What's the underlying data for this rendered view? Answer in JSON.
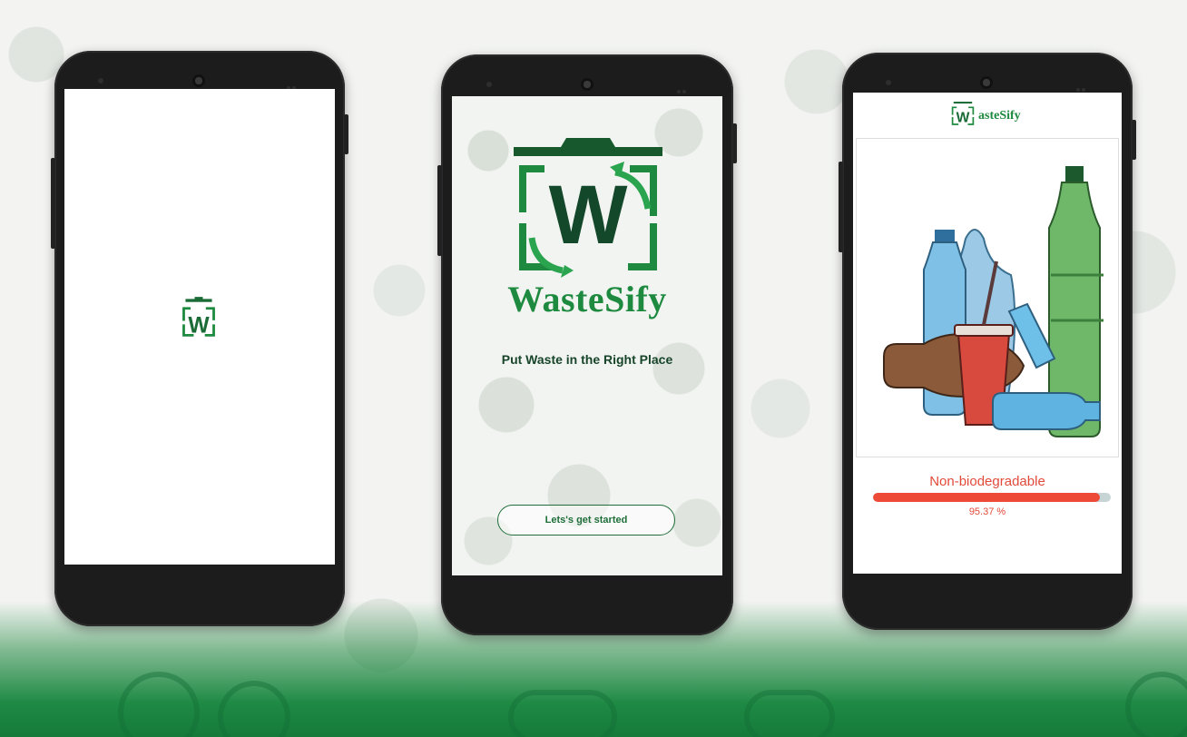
{
  "splash": {
    "brand": "WasteSify",
    "tagline": "Put Waste in the Right Place",
    "start_button": "Lets's get started"
  },
  "logo": {
    "letter": "W"
  },
  "result": {
    "header_brand": "asteSify",
    "classification": "Non-biodegradable",
    "confidence_text": "95.37 %",
    "confidence_value": 95.37
  },
  "colors": {
    "brand_green": "#1e8a3f",
    "dark_green": "#17452a",
    "alert_red": "#ee4a38",
    "track": "#c7d4d6"
  },
  "icons": [
    "recycle-bin-logo-icon",
    "waste-items-illustration"
  ]
}
